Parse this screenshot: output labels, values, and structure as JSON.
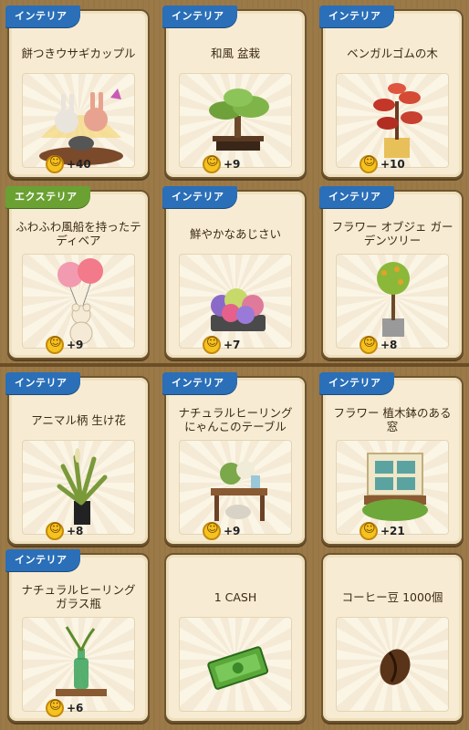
{
  "colors": {
    "badge_interior": "#2a6fb8",
    "badge_exterior": "#6aa132",
    "card_bg": "#f7ecd3",
    "frame": "#9c7a48"
  },
  "items": [
    {
      "badge": "インテリア",
      "badge_type": "interior",
      "title": "餅つきウサギカップル",
      "bonus": "+40",
      "icon": "bunny-couple-icon"
    },
    {
      "badge": "インテリア",
      "badge_type": "interior",
      "title": "和風 盆栽",
      "bonus": "+9",
      "icon": "bonsai-icon"
    },
    {
      "badge": "インテリア",
      "badge_type": "interior",
      "title": "ベンガルゴムの木",
      "bonus": "+10",
      "icon": "rubber-tree-icon"
    },
    {
      "badge": "エクステリア",
      "badge_type": "exterior",
      "title": "ふわふわ風船を持ったテディベア",
      "bonus": "+9",
      "icon": "teddy-balloon-icon"
    },
    {
      "badge": "インテリア",
      "badge_type": "interior",
      "title": "鮮やかなあじさい",
      "bonus": "+7",
      "icon": "hydrangea-icon"
    },
    {
      "badge": "インテリア",
      "badge_type": "interior",
      "title": "フラワー オブジェ ガーデンツリー",
      "bonus": "+8",
      "icon": "garden-tree-icon"
    },
    {
      "badge": "インテリア",
      "badge_type": "interior",
      "title": "アニマル柄 生け花",
      "bonus": "+8",
      "icon": "ikebana-icon"
    },
    {
      "badge": "インテリア",
      "badge_type": "interior",
      "title": "ナチュラルヒーリング にゃんこのテーブル",
      "bonus": "+9",
      "icon": "cat-table-icon"
    },
    {
      "badge": "インテリア",
      "badge_type": "interior",
      "title": "フラワー 植木鉢のある窓",
      "bonus": "+21",
      "icon": "flower-window-icon"
    },
    {
      "badge": "インテリア",
      "badge_type": "interior",
      "title": "ナチュラルヒーリング ガラス瓶",
      "bonus": "+6",
      "icon": "glass-bottle-icon"
    },
    {
      "badge": "",
      "badge_type": "none",
      "title": "1 CASH",
      "bonus": "",
      "icon": "cash-icon"
    },
    {
      "badge": "",
      "badge_type": "none",
      "title": "コーヒー豆 1000個",
      "bonus": "",
      "icon": "coffee-bean-icon"
    }
  ]
}
